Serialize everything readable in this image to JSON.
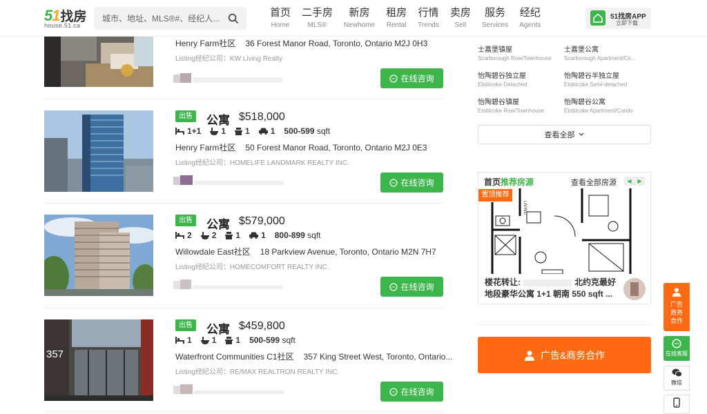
{
  "header": {
    "logo_text": "51找房",
    "logo_sub": "house.51.ca",
    "search_placeholder": "城市、地址、MLS®#、经纪人...",
    "nav": [
      {
        "cn": "首页",
        "en": "Home"
      },
      {
        "cn": "二手房",
        "en": "MLS®"
      },
      {
        "cn": "新房",
        "en": "Newhome"
      },
      {
        "cn": "租房",
        "en": "Rental"
      },
      {
        "cn": "行情",
        "en": "Trends"
      },
      {
        "cn": "卖房",
        "en": "Sell"
      },
      {
        "cn": "服务",
        "en": "Services"
      },
      {
        "cn": "经纪",
        "en": "Agents"
      }
    ],
    "app_title": "51找房APP",
    "app_sub": "立即下载"
  },
  "listings": [
    {
      "community": "Henry Farm社区",
      "address": "36 Forest Manor Road, Toronto, Ontario M2J 0H3",
      "brokerage": "Listing经纪公司：KW Living Realty",
      "consult": "在线咨询"
    },
    {
      "tag": "出售",
      "type": "公寓",
      "price": "$518,000",
      "beds": "1+1",
      "baths": "1",
      "kitchens": "1",
      "parking": "1",
      "sqft": "500-599",
      "sqft_unit": "sqft",
      "community": "Henry Farm社区",
      "address": "50 Forest Manor Road, Toronto, Ontario M2J 0E3",
      "brokerage": "Listing经纪公司：HOMELIFE LANDMARK REALTY INC.",
      "consult": "在线咨询"
    },
    {
      "tag": "出售",
      "type": "公寓",
      "price": "$579,000",
      "beds": "2",
      "baths": "2",
      "kitchens": "1",
      "parking": "1",
      "sqft": "800-899",
      "sqft_unit": "sqft",
      "community": "Willowdale East社区",
      "address": "18 Parkview Avenue, Toronto, Ontario M2N 7H7",
      "brokerage": "Listing经纪公司：HOMECOMFORT REALTY INC.",
      "consult": "在线咨询"
    },
    {
      "tag": "出售",
      "type": "公寓",
      "price": "$459,800",
      "beds": "1",
      "baths": "1",
      "kitchens": "1",
      "sqft": "500-599",
      "sqft_unit": "sqft",
      "community": "Waterfront Communities C1社区",
      "address": "357 King Street West, Toronto, Ontario...",
      "brokerage": "Listing经纪公司：RE/MAX REALTRON REALTY INC.",
      "consult": "在线咨询",
      "photo_number": "357"
    }
  ],
  "sidebar": {
    "cities": [
      {
        "cn": "士嘉堡镇屋",
        "en": "Scarborough Row/Townhouse"
      },
      {
        "cn": "士嘉堡公寓",
        "en": "Scarborough Apartment/Co..."
      },
      {
        "cn": "怡陶碧谷独立屋",
        "en": "Etobicoke Detached"
      },
      {
        "cn": "怡陶碧谷半独立屋",
        "en": "Etobicoke Semi-detached"
      },
      {
        "cn": "怡陶碧谷镇屋",
        "en": "Etobicoke Row/Townhouse"
      },
      {
        "cn": "怡陶碧谷公寓",
        "en": "Etobicoke Apartment/Condo"
      }
    ],
    "view_all": "查看全部",
    "rec_title_a": "首页",
    "rec_title_b": "推荐房源",
    "rec_view_all": "查看全部房源",
    "rec_badge": "置顶推荐",
    "rec_text_line1": "楼花转让:",
    "rec_text_line1b": "北约克最好",
    "rec_text_line2": "地段豪华公寓 1+1 朝南 550 sqft ...",
    "ad_button": "广告&商务合作"
  },
  "float": {
    "ad": "广告商务合作",
    "cs": "在线客服",
    "wx": "微信"
  },
  "colors": {
    "green": "#3cb54a",
    "orange": "#ff6a13"
  }
}
